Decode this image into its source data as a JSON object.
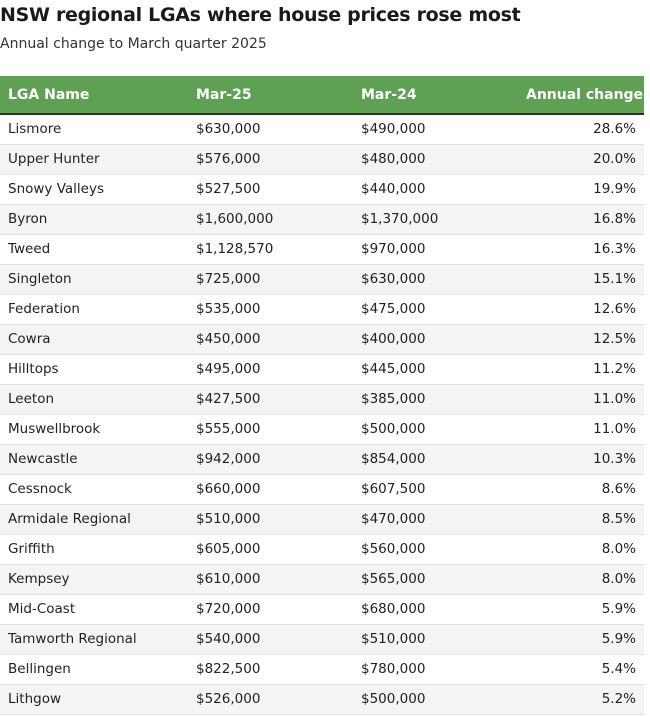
{
  "title": "NSW regional LGAs where house prices rose most",
  "subtitle": "Annual change to March quarter 2025",
  "colors": {
    "header_bg": "#5fa055",
    "header_text": "#ffffff",
    "row_alt": "#f4f4f4"
  },
  "chart_data": {
    "type": "table",
    "title": "NSW regional LGAs where house prices rose most",
    "subtitle": "Annual change to March quarter 2025",
    "columns": [
      "LGA Name",
      "Mar-25",
      "Mar-24",
      "Annual change"
    ],
    "rows": [
      [
        "Lismore",
        "$630,000",
        "$490,000",
        "28.6%"
      ],
      [
        "Upper Hunter",
        "$576,000",
        "$480,000",
        "20.0%"
      ],
      [
        "Snowy Valleys",
        "$527,500",
        "$440,000",
        "19.9%"
      ],
      [
        "Byron",
        "$1,600,000",
        "$1,370,000",
        "16.8%"
      ],
      [
        "Tweed",
        "$1,128,570",
        "$970,000",
        "16.3%"
      ],
      [
        "Singleton",
        "$725,000",
        "$630,000",
        "15.1%"
      ],
      [
        "Federation",
        "$535,000",
        "$475,000",
        "12.6%"
      ],
      [
        "Cowra",
        "$450,000",
        "$400,000",
        "12.5%"
      ],
      [
        "Hilltops",
        "$495,000",
        "$445,000",
        "11.2%"
      ],
      [
        "Leeton",
        "$427,500",
        "$385,000",
        "11.0%"
      ],
      [
        "Muswellbrook",
        "$555,000",
        "$500,000",
        "11.0%"
      ],
      [
        "Newcastle",
        "$942,000",
        "$854,000",
        "10.3%"
      ],
      [
        "Cessnock",
        "$660,000",
        "$607,500",
        "8.6%"
      ],
      [
        "Armidale Regional",
        "$510,000",
        "$470,000",
        "8.5%"
      ],
      [
        "Griffith",
        "$605,000",
        "$560,000",
        "8.0%"
      ],
      [
        "Kempsey",
        "$610,000",
        "$565,000",
        "8.0%"
      ],
      [
        "Mid-Coast",
        "$720,000",
        "$680,000",
        "5.9%"
      ],
      [
        "Tamworth Regional",
        "$540,000",
        "$510,000",
        "5.9%"
      ],
      [
        "Bellingen",
        "$822,500",
        "$780,000",
        "5.4%"
      ],
      [
        "Lithgow",
        "$526,000",
        "$500,000",
        "5.2%"
      ]
    ]
  }
}
